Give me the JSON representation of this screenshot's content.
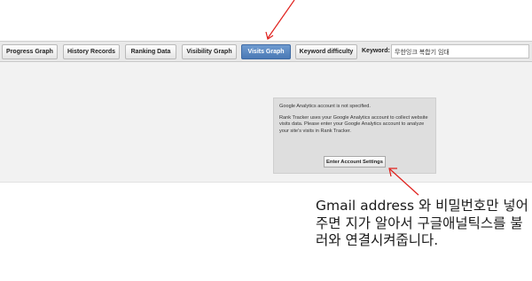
{
  "toolbar": {
    "tabs": [
      {
        "label": "Progress Graph"
      },
      {
        "label": "History Records"
      },
      {
        "label": "Ranking Data"
      },
      {
        "label": "Visibility Graph"
      },
      {
        "label": "Visits Graph",
        "active": true
      },
      {
        "label": "Keyword difficulty"
      }
    ],
    "keyword_label": "Keyword:",
    "keyword_value": "무한잉크 복합기 임대"
  },
  "analytics_panel": {
    "message": "Google Analytics account is not specified.",
    "description": "Rank Tracker uses your Google Analytics account to collect website visits data. Please enter your Google Analytics account to analyze your site's visits in Rank Tracker.",
    "button_label": "Enter Account Settings"
  },
  "annotation": {
    "text": "Gmail address 와 비밀번호만 넣어주면 지가 알아서 구글애널틱스를 불러와 연결시켜줍니다.",
    "arrow_color": "#e0201c"
  }
}
